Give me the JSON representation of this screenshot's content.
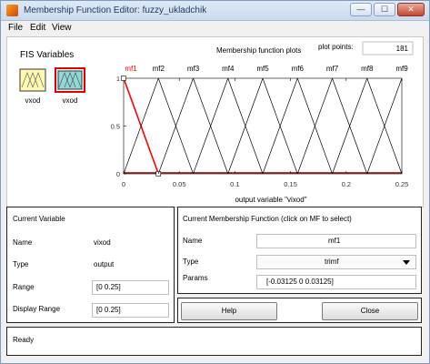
{
  "window": {
    "title": "Membership Function Editor: fuzzy_ukladchik",
    "minimize_glyph": "—",
    "maximize_glyph": "☐",
    "close_glyph": "✕"
  },
  "menu": {
    "file": "File",
    "edit": "Edit",
    "view": "View"
  },
  "fis": {
    "heading": "FIS Variables",
    "input_label": "vxod",
    "output_label": "vxod"
  },
  "plot": {
    "title": "Membership function plots",
    "plot_points_label": "plot points:",
    "plot_points_value": "181",
    "xlabel": "output variable \"vixod\"",
    "x_ticks": [
      "0",
      "0.05",
      "0.1",
      "0.15",
      "0.2",
      "0.25"
    ],
    "y_ticks": [
      "1",
      "0.5",
      "0"
    ],
    "mf_labels": [
      "mf1",
      "mf2",
      "mf3",
      "mf4",
      "mf5",
      "mf6",
      "mf7",
      "mf8",
      "mf9"
    ],
    "selected_color": "#ff0000",
    "line_color": "#000000",
    "baseline_color": "#8b0000"
  },
  "chart_data": {
    "type": "line",
    "xlabel": "output variable \"vixod\"",
    "xlim": [
      0,
      0.25
    ],
    "ylim": [
      0,
      1
    ],
    "series": [
      {
        "name": "mf1",
        "x": [
          -0.03125,
          0,
          0.03125
        ],
        "y": [
          0,
          1,
          0
        ]
      },
      {
        "name": "mf2",
        "x": [
          0,
          0.03125,
          0.0625
        ],
        "y": [
          0,
          1,
          0
        ]
      },
      {
        "name": "mf3",
        "x": [
          0.03125,
          0.0625,
          0.09375
        ],
        "y": [
          0,
          1,
          0
        ]
      },
      {
        "name": "mf4",
        "x": [
          0.0625,
          0.09375,
          0.125
        ],
        "y": [
          0,
          1,
          0
        ]
      },
      {
        "name": "mf5",
        "x": [
          0.09375,
          0.125,
          0.15625
        ],
        "y": [
          0,
          1,
          0
        ]
      },
      {
        "name": "mf6",
        "x": [
          0.125,
          0.15625,
          0.1875
        ],
        "y": [
          0,
          1,
          0
        ]
      },
      {
        "name": "mf7",
        "x": [
          0.15625,
          0.1875,
          0.21875
        ],
        "y": [
          0,
          1,
          0
        ]
      },
      {
        "name": "mf8",
        "x": [
          0.1875,
          0.21875,
          0.25
        ],
        "y": [
          0,
          1,
          0
        ]
      },
      {
        "name": "mf9",
        "x": [
          0.21875,
          0.25,
          0.28125
        ],
        "y": [
          0,
          1,
          0
        ]
      }
    ],
    "selected": "mf1"
  },
  "current_variable": {
    "heading": "Current Variable",
    "name_label": "Name",
    "name_value": "vixod",
    "type_label": "Type",
    "type_value": "output",
    "range_label": "Range",
    "range_value": "[0 0.25]",
    "display_range_label": "Display Range",
    "display_range_value": "[0 0.25]"
  },
  "current_mf": {
    "heading": "Current Membership Function (click on MF to select)",
    "name_label": "Name",
    "name_value": "mf1",
    "type_label": "Type",
    "type_value": "trimf",
    "params_label": "Params",
    "params_value": "[-0.03125 0 0.03125]"
  },
  "buttons": {
    "help": "Help",
    "close": "Close"
  },
  "status": {
    "text": "Ready"
  }
}
